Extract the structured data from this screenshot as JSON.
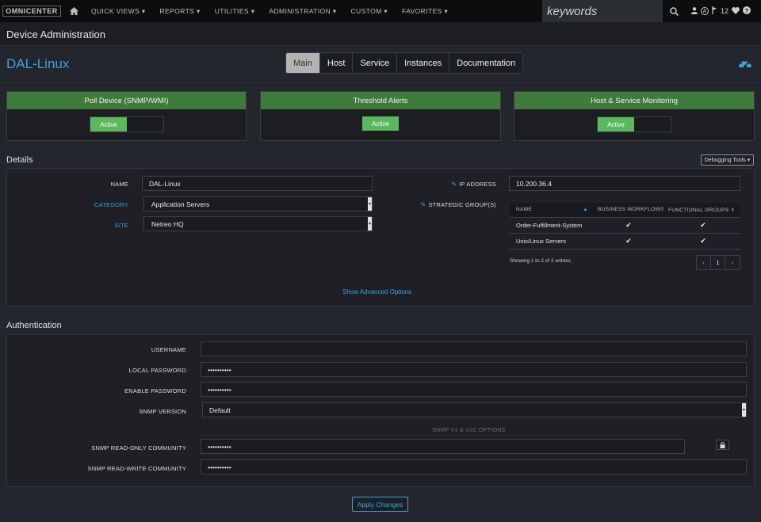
{
  "topnav": {
    "logo": "OMNICENTER",
    "items": [
      "QUICK VIEWS ▾",
      "REPORTS ▾",
      "UTILITIES ▾",
      "ADMINISTRATION ▾",
      "CUSTOM ▾",
      "FAVORITES ▾"
    ],
    "search_placeholder": "keywords",
    "user_badge": "A",
    "alert_count": "12",
    "icons": [
      "home-icon",
      "search-icon",
      "user-icon",
      "flag-icon",
      "heart-icon",
      "help-icon"
    ]
  },
  "page": {
    "title": "Device Administration",
    "device_name": "DAL-Linux"
  },
  "tabs": [
    {
      "label": "Main",
      "active": true
    },
    {
      "label": "Host",
      "active": false
    },
    {
      "label": "Service",
      "active": false
    },
    {
      "label": "Instances",
      "active": false
    },
    {
      "label": "Documentation",
      "active": false
    }
  ],
  "panels": {
    "poll": {
      "title": "Poll Device (SNMP/WMI)",
      "state": "Active"
    },
    "threshold": {
      "title": "Threshold Alerts",
      "state": "Active"
    },
    "monitoring": {
      "title": "Host & Service Monitoring",
      "state": "Active"
    }
  },
  "details": {
    "title": "Details",
    "debug_label": "Debugging Tools ▾",
    "name_label": "NAME",
    "name_value": "DAL-Linux",
    "category_label": "CATEGORY",
    "category_value": "Application Servers",
    "site_label": "SITE",
    "site_value": "Netreo HQ",
    "ip_label": "IP ADDRESS",
    "ip_value": "10.200.36.4",
    "groups_label": "STRATEGIC GROUP(S)",
    "table": {
      "headers": [
        "NAME",
        "BUSINESS WORKFLOWS",
        "FUNCTIONAL GROUPS"
      ],
      "rows": [
        {
          "name": "Order-Fulfillment-System",
          "workflow": "✔",
          "functional": "✔"
        },
        {
          "name": "Unix/Linux Servers",
          "workflow": "✔",
          "functional": "✔"
        }
      ],
      "showing": "Showing 1 to 2 of 2 entries",
      "pager": {
        "prev": "‹",
        "page": "1",
        "next": "›"
      }
    },
    "advanced_link": "Show Advanced Options"
  },
  "auth": {
    "title": "Authentication",
    "username_label": "USERNAME",
    "username_value": "",
    "local_pw_label": "LOCAL PASSWORD",
    "local_pw_value": "••••••••••",
    "enable_pw_label": "ENABLE PASSWORD",
    "enable_pw_value": "••••••••••",
    "snmp_version_label": "SNMP VERSION",
    "snmp_version_value": "Default",
    "snmp_options_heading": "SNMP V1 & V2C OPTIONS",
    "ro_label": "SNMP READ-ONLY COMMUNITY",
    "ro_value": "••••••••••",
    "rw_label": "SNMP READ-WRITE COMMUNITY",
    "rw_value": "••••••••••"
  },
  "apply_label": "Apply Changes",
  "colors": {
    "accent": "#3aa3e3",
    "success": "#5cb85c",
    "panel_header": "#3f7b3a"
  }
}
